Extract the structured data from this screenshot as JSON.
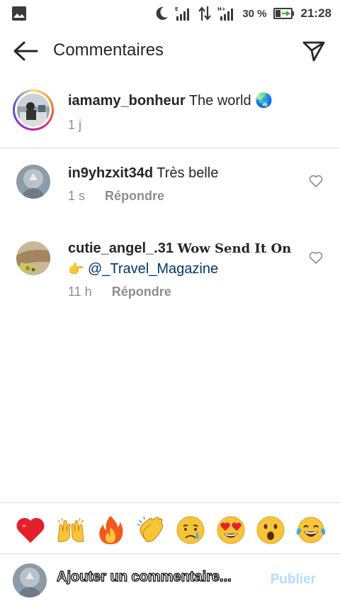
{
  "status_bar": {
    "battery_percent": "30 %",
    "time": "21:28",
    "icons": [
      "image-icon",
      "moon-icon",
      "signal-icon",
      "data-transfer-icon",
      "signal-icon",
      "battery-icon"
    ]
  },
  "header": {
    "title": "Commentaires",
    "icons": [
      "back-arrow-icon",
      "send-icon"
    ]
  },
  "caption": {
    "username": "iamamy_bonheur",
    "text": "The world 🌏",
    "time": "1 j"
  },
  "comments": [
    {
      "username": "in9yhzxit34d",
      "text": "Très belle",
      "time": "1 s",
      "reply_label": "Répondre"
    },
    {
      "username": "cutie_angel_.31",
      "text": "Wow Send It On👉",
      "mention": "@_Travel_Magazine",
      "time": "11 h",
      "reply_label": "Répondre"
    }
  ],
  "emoji_bar": [
    "❤️",
    "🙌",
    "🔥",
    "👏",
    "😢",
    "😍",
    "😮",
    "😂"
  ],
  "input": {
    "placeholder": "Ajouter un commentaire...",
    "publish_label": "Publier"
  },
  "colors": {
    "text": "#262626",
    "secondary": "#8e8e8e",
    "link": "#00376b",
    "publish_disabled": "#b3dbff",
    "divider": "#dbdbdb"
  }
}
